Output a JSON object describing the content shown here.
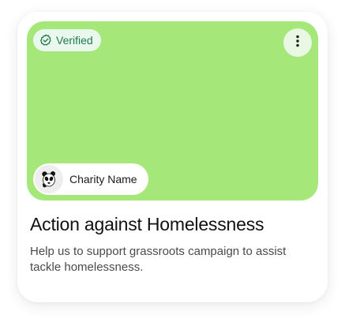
{
  "card": {
    "verified_label": "Verified",
    "menu_icon": "more-vertical-icon",
    "charity_logo_icon": "panda-icon",
    "charity_name": "Charity Name",
    "title": "Action against Homelessness",
    "description": "Help us to support grassroots campaign to assist tackle homelessness."
  },
  "colors": {
    "hero_background": "#a6e77a",
    "verified_text": "#1f7a4a",
    "verified_background": "#eaf7ee"
  }
}
